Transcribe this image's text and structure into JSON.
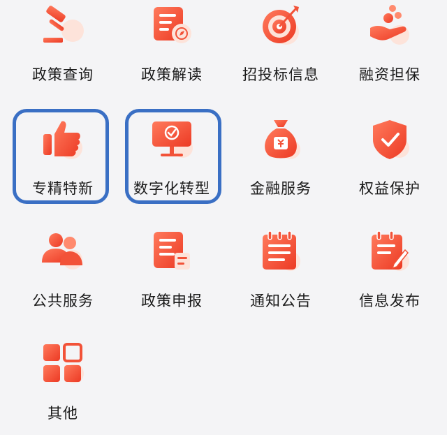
{
  "menu": {
    "items": [
      {
        "label": "政策查询",
        "icon": "gavel-icon"
      },
      {
        "label": "政策解读",
        "icon": "document-compass-icon"
      },
      {
        "label": "招投标信息",
        "icon": "target-icon"
      },
      {
        "label": "融资担保",
        "icon": "hand-coins-icon"
      },
      {
        "label": "专精特新",
        "icon": "thumbs-up-icon"
      },
      {
        "label": "数字化转型",
        "icon": "monitor-check-icon"
      },
      {
        "label": "金融服务",
        "icon": "money-bag-icon"
      },
      {
        "label": "权益保护",
        "icon": "shield-check-icon"
      },
      {
        "label": "公共服务",
        "icon": "people-icon"
      },
      {
        "label": "政策申报",
        "icon": "report-form-icon"
      },
      {
        "label": "通知公告",
        "icon": "notepad-icon"
      },
      {
        "label": "信息发布",
        "icon": "document-edit-icon"
      },
      {
        "label": "其他",
        "icon": "grid-icon"
      }
    ],
    "highlighted": [
      "专精特新",
      "数字化转型"
    ]
  },
  "colors": {
    "icon_primary": "#f25238",
    "icon_secondary": "#ff8a6e",
    "icon_bubble": "#fde3da",
    "highlight_border": "#3a6fc4",
    "label_text": "#1a1a1a",
    "background": "#f4f4f6"
  }
}
